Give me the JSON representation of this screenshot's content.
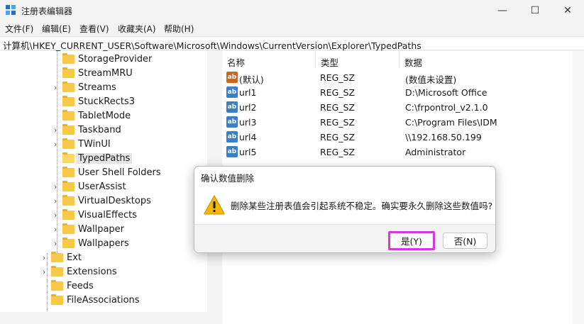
{
  "window": {
    "title": "注册表编辑器",
    "minimize_glyph": "—",
    "maximize_glyph": "☐",
    "close_glyph": "✕"
  },
  "menu": [
    "文件(F)",
    "编辑(E)",
    "查看(V)",
    "收藏夹(A)",
    "帮助(H)"
  ],
  "address": "计算机\\HKEY_CURRENT_USER\\Software\\Microsoft\\Windows\\CurrentVersion\\Explorer\\TypedPaths",
  "tree": [
    {
      "label": "StorageProvider",
      "level": 2,
      "expandable": false,
      "selected": false
    },
    {
      "label": "StreamMRU",
      "level": 2,
      "expandable": false,
      "selected": false
    },
    {
      "label": "Streams",
      "level": 2,
      "expandable": true,
      "selected": false
    },
    {
      "label": "StuckRects3",
      "level": 2,
      "expandable": false,
      "selected": false
    },
    {
      "label": "TabletMode",
      "level": 2,
      "expandable": false,
      "selected": false
    },
    {
      "label": "Taskband",
      "level": 2,
      "expandable": true,
      "selected": false
    },
    {
      "label": "TWinUI",
      "level": 2,
      "expandable": true,
      "selected": false
    },
    {
      "label": "TypedPaths",
      "level": 2,
      "expandable": false,
      "selected": true
    },
    {
      "label": "User Shell Folders",
      "level": 2,
      "expandable": false,
      "selected": false
    },
    {
      "label": "UserAssist",
      "level": 2,
      "expandable": true,
      "selected": false
    },
    {
      "label": "VirtualDesktops",
      "level": 2,
      "expandable": true,
      "selected": false
    },
    {
      "label": "VisualEffects",
      "level": 2,
      "expandable": true,
      "selected": false
    },
    {
      "label": "Wallpaper",
      "level": 2,
      "expandable": true,
      "selected": false
    },
    {
      "label": "Wallpapers",
      "level": 2,
      "expandable": true,
      "selected": false
    },
    {
      "label": "Ext",
      "level": 1,
      "expandable": true,
      "selected": false
    },
    {
      "label": "Extensions",
      "level": 1,
      "expandable": true,
      "selected": false
    },
    {
      "label": "Feeds",
      "level": 1,
      "expandable": false,
      "selected": false
    },
    {
      "label": "FileAssociations",
      "level": 1,
      "expandable": false,
      "selected": false
    }
  ],
  "tree_chevron": "›",
  "columns": {
    "name": "名称",
    "type": "类型",
    "data": "数据"
  },
  "values": [
    {
      "name": "(默认)",
      "type": "REG_SZ",
      "data": "(数值未设置)",
      "icon": "ab"
    },
    {
      "name": "url1",
      "type": "REG_SZ",
      "data": "D:\\Microsoft Office",
      "icon": "ab"
    },
    {
      "name": "url2",
      "type": "REG_SZ",
      "data": "C:\\frpontrol_v2.1.0",
      "icon": "ab"
    },
    {
      "name": "url3",
      "type": "REG_SZ",
      "data": "C:\\Program Files\\IDM",
      "icon": "ab"
    },
    {
      "name": "url4",
      "type": "REG_SZ",
      "data": "\\\\192.168.50.199",
      "icon": "ab"
    },
    {
      "name": "url5",
      "type": "REG_SZ",
      "data": "Administrator",
      "icon": "ab"
    }
  ],
  "dialog": {
    "title": "确认数值删除",
    "message": "删除某些注册表值会引起系统不稳定。确实要永久删除这些数值吗?",
    "yes_label": "是(Y)",
    "no_label": "否(N)"
  },
  "colors": {
    "folder": "#f7c948",
    "highlight_border": "#d63ad6",
    "warning": "#f5b800"
  }
}
